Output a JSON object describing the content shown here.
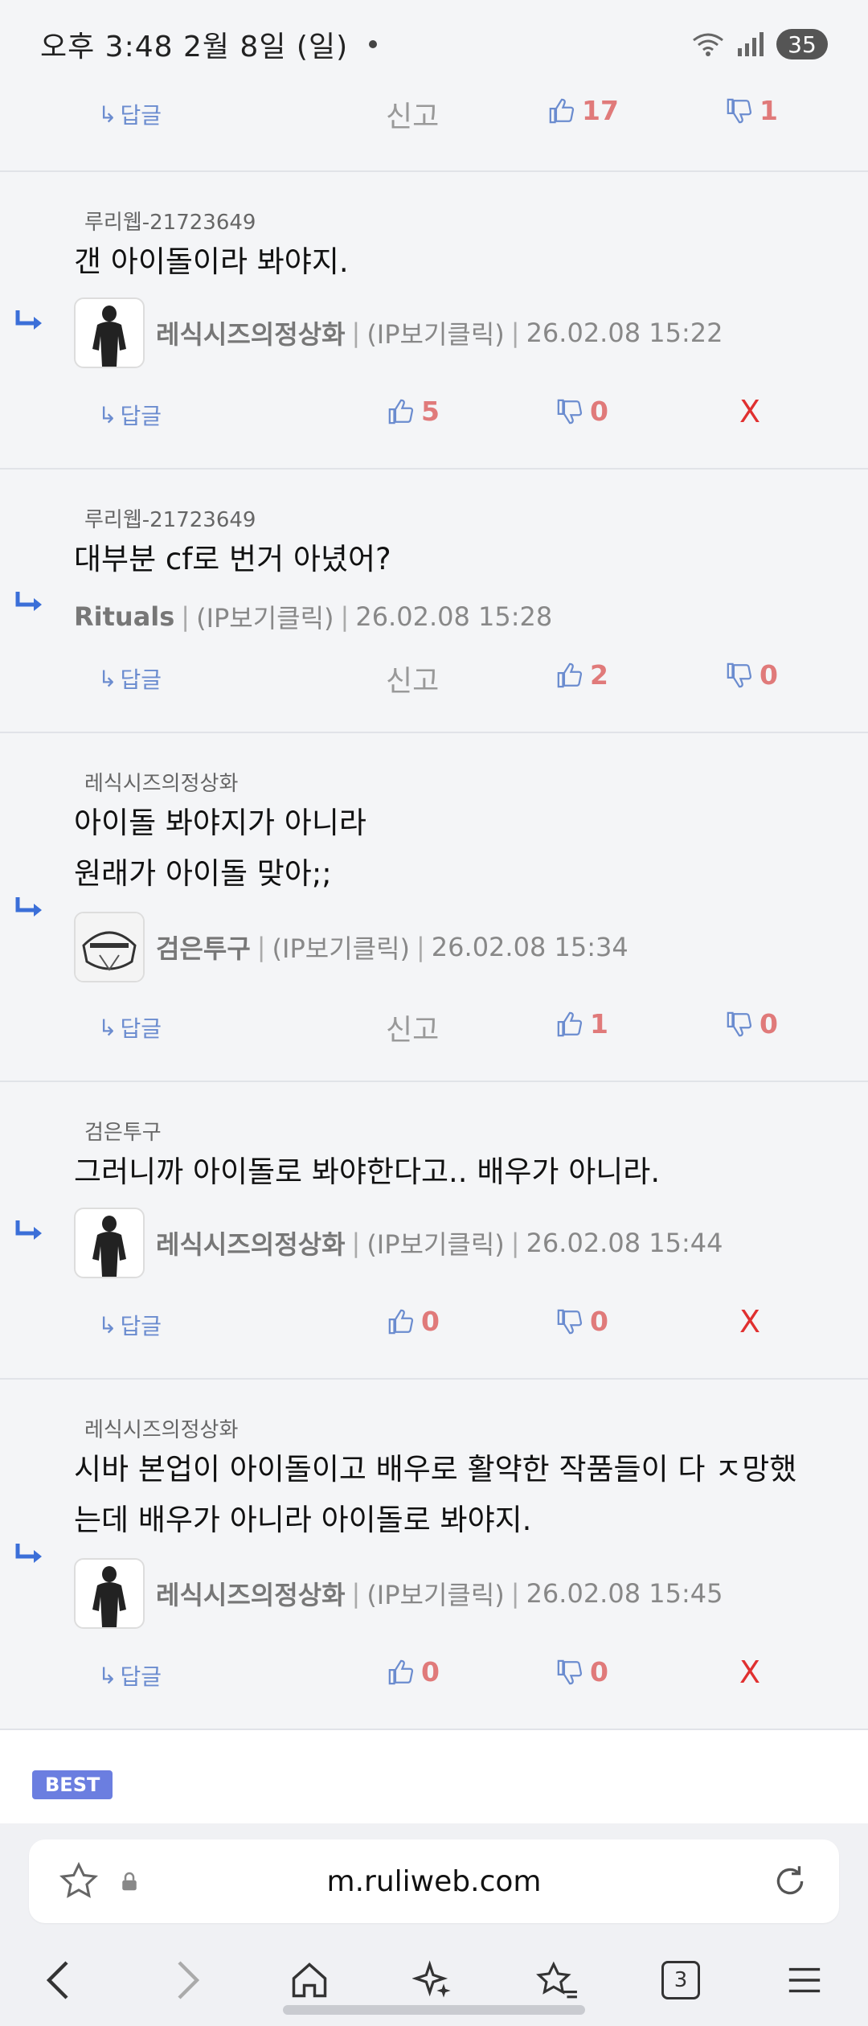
{
  "status_bar": {
    "time": "오후 3:48  2월 8일 (일)",
    "battery": "35"
  },
  "top_actions": {
    "reply": "답글",
    "report": "신고",
    "likes": "17",
    "dislikes": "1"
  },
  "comments": [
    {
      "parent": "루리웹-21723649",
      "text": "갠 아이돌이라 봐야지.",
      "author": "레식시즈의정상화",
      "ip": "(IP보기클릭)",
      "date": "26.02.08 15:22",
      "reply": "답글",
      "likes": "5",
      "dislikes": "0",
      "delete": "X"
    },
    {
      "parent": "루리웹-21723649",
      "text": "대부분 cf로 번거 아녔어?",
      "author": "Rituals",
      "ip": "(IP보기클릭)",
      "date": "26.02.08 15:28",
      "reply": "답글",
      "report": "신고",
      "likes": "2",
      "dislikes": "0"
    },
    {
      "parent": "레식시즈의정상화",
      "text_line1": "아이돌 봐야지가 아니라",
      "text_line2": "원래가 아이돌 맞아;;",
      "author": "검은투구",
      "ip": "(IP보기클릭)",
      "date": "26.02.08 15:34",
      "reply": "답글",
      "report": "신고",
      "likes": "1",
      "dislikes": "0"
    },
    {
      "parent": "검은투구",
      "text": "그러니까 아이돌로 봐야한다고.. 배우가 아니라.",
      "author": "레식시즈의정상화",
      "ip": "(IP보기클릭)",
      "date": "26.02.08 15:44",
      "reply": "답글",
      "likes": "0",
      "dislikes": "0",
      "delete": "X"
    },
    {
      "parent": "레식시즈의정상화",
      "text_line1": "시바 본업이 아이돌이고 배우로 활약한 작품들이 다 ㅈ망했",
      "text_line2": "는데 배우가 아니라 아이돌로 봐야지.",
      "author": "레식시즈의정상화",
      "ip": "(IP보기클릭)",
      "date": "26.02.08 15:45",
      "reply": "답글",
      "likes": "0",
      "dislikes": "0",
      "delete": "X"
    }
  ],
  "best_badge": "BEST",
  "browser": {
    "url": "m.ruliweb.com",
    "tab_count": "3"
  },
  "colors": {
    "accent": "#6b8ccf",
    "count": "#e07a7a",
    "delete": "#e03030",
    "best": "#6b7ee0"
  }
}
